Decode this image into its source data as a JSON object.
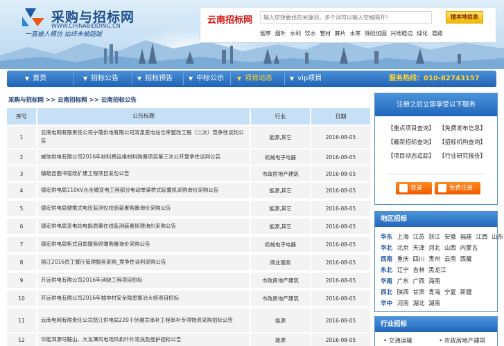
{
  "header": {
    "logo_title": "采购与招标网",
    "logo_url": "WWW.CHINABIDDING.CN",
    "slogan": "一直被人模仿    始终未被超越",
    "search_site": "云南招标网",
    "search_placeholder": "输入您想要找的关键词，多个词可以输入空格隔开！",
    "search_button": "搜本地信息",
    "hot_words": [
      "烟草",
      "烟叶",
      "水利",
      "饮水",
      "管材",
      "麻片",
      "水库",
      "除险加固",
      "兴地睦边",
      "绿化",
      "道路"
    ]
  },
  "nav": {
    "items": [
      {
        "label": "首页",
        "active": false
      },
      {
        "label": "招标公告",
        "active": false
      },
      {
        "label": "招标预告",
        "active": false
      },
      {
        "label": "中标公示",
        "active": false
      },
      {
        "label": "项目动态",
        "active": true
      },
      {
        "label": "vip项目",
        "active": false
      }
    ],
    "hotline": "服务热线：010-82743157"
  },
  "breadcrumb": "采购与招标网 >> 云南招标网 >> 云南招标公告",
  "table": {
    "headers": [
      "序号",
      "公告标题",
      "行业",
      "日期"
    ],
    "rows": [
      {
        "no": "1",
        "title": "云南电网有限责任公司宁蒗供电有限公司清泉变电站仓库整改工程（二次）竞争性谈判公告",
        "industry": "能源,其它",
        "date": "2016-08-05"
      },
      {
        "no": "2",
        "title": "威信供电有限公司2016年材料费运维材料购置项目第三次公开竞争性谈判公告",
        "industry": "机械电子电器",
        "date": "2016-08-05"
      },
      {
        "no": "3",
        "title": "镇雄县图书馆改扩建工程项目发包公告",
        "industry": "市政房地产建筑",
        "date": "2016-08-05"
      },
      {
        "no": "4",
        "title": "德宏供电局110kV允全输变电工程部分电动单梁桥式起重机采购询价采购公告",
        "industry": "能源,其它",
        "date": "2016-08-05"
      },
      {
        "no": "5",
        "title": "德宏供电局便携式电压监测仪校验装置购置询价采购公告",
        "industry": "能源,其它",
        "date": "2016-08-05"
      },
      {
        "no": "6",
        "title": "德宏供电局变电站电能质量在线监测装置修理询价采购公告",
        "industry": "能源,其它",
        "date": "2016-08-05"
      },
      {
        "no": "7",
        "title": "德宏供电局柜式自助服务终端购置询价采购公告",
        "industry": "机械电子电器",
        "date": "2016-08-05"
      },
      {
        "no": "8",
        "title": "丽江2016员工餐厅管理服务采购_竞争性谈判采购公告",
        "industry": "商业服务",
        "date": "2016-08-05"
      },
      {
        "no": "9",
        "title": "开远供电有限公司2016年消缺工程项目招标",
        "industry": "市政房地产建筑",
        "date": "2016-08-05"
      },
      {
        "no": "10",
        "title": "开远供电有限公司2016年城中村安全隐患整治大修项目招标",
        "industry": "市政房地产建筑",
        "date": "2016-08-05"
      },
      {
        "no": "11",
        "title": "云南电网有限责任公司怒江供电局220千伏福贡串补工程串补专项物资采购招标公告",
        "industry": "能源",
        "date": "2016-08-05"
      },
      {
        "no": "12",
        "title": "华能洱源马鞍山、大龙潭风电场风机叶片清洗及维护招标公告",
        "industry": "能源",
        "date": "2016-08-05"
      }
    ]
  },
  "register_panel": {
    "title": "注册之后立即享受以下服务",
    "services": [
      "【重点项目查询】",
      "【免费发布信息】",
      "【最新招标查询】",
      "【招标机构查询】",
      "【项目动态追踪】",
      "【行业研究报告】"
    ],
    "login_label": "登录",
    "signup_label": "免费注册"
  },
  "region_panel": {
    "title": "地区招标",
    "regions": [
      {
        "name": "华东",
        "provinces": [
          "上海",
          "江苏",
          "浙江",
          "安徽",
          "福建",
          "江西",
          "山东"
        ]
      },
      {
        "name": "华北",
        "provinces": [
          "北京",
          "天津",
          "河北",
          "山西",
          "内蒙古"
        ]
      },
      {
        "name": "西南",
        "provinces": [
          "重庆",
          "四川",
          "贵州",
          "云南",
          "西藏"
        ]
      },
      {
        "name": "东北",
        "provinces": [
          "辽宁",
          "吉林",
          "黑龙江"
        ]
      },
      {
        "name": "华南",
        "provinces": [
          "广东",
          "广西",
          "海南"
        ]
      },
      {
        "name": "西北",
        "provinces": [
          "陕西",
          "甘肃",
          "青海",
          "宁夏",
          "新疆"
        ]
      },
      {
        "name": "华中",
        "provinces": [
          "河南",
          "湖北",
          "湖南"
        ]
      }
    ]
  },
  "industry_panel": {
    "title": "行业招标",
    "items": [
      "交通运输",
      "市政房地产建筑"
    ]
  },
  "colors": {
    "nav_blue": "#2166b9",
    "header_cell": "#c6e0f5",
    "accent_red": "#d41212",
    "button_orange": "#f05a00",
    "hotline_yellow": "#ffd633"
  }
}
